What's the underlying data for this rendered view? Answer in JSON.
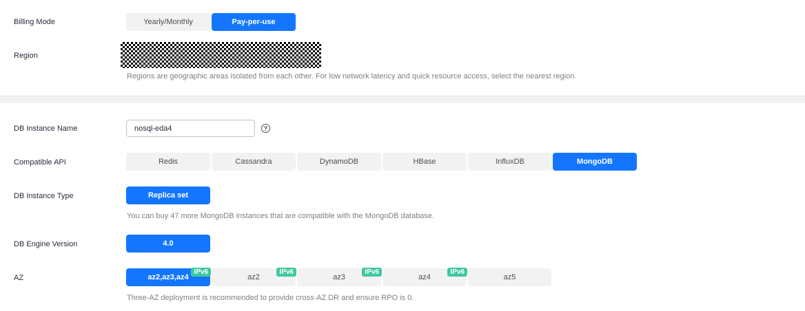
{
  "billing": {
    "label": "Billing Mode",
    "options": [
      "Yearly/Monthly",
      "Pay-per-use"
    ],
    "selected": "Pay-per-use"
  },
  "region": {
    "label": "Region",
    "hint": "Regions are geographic areas isolated from each other. For low network latency and quick resource access, select the nearest region."
  },
  "instance_name": {
    "label": "DB Instance Name",
    "value": "nosql-eda4",
    "help": "?"
  },
  "compatible_api": {
    "label": "Compatible API",
    "options": [
      "Redis",
      "Cassandra",
      "DynamoDB",
      "HBase",
      "InfluxDB",
      "MongoDB"
    ],
    "selected": "MongoDB"
  },
  "instance_type": {
    "label": "DB Instance Type",
    "option": "Replica set",
    "hint": "You can buy 47 more MongoDB instances that are compatible with the MongoDB database."
  },
  "engine_version": {
    "label": "DB Engine Version",
    "option": "4.0"
  },
  "az": {
    "label": "AZ",
    "options": [
      {
        "name": "az2,az3,az4",
        "badge": "IPv6"
      },
      {
        "name": "az2",
        "badge": "IPv6"
      },
      {
        "name": "az3",
        "badge": "IPv6"
      },
      {
        "name": "az4",
        "badge": "IPv6"
      },
      {
        "name": "az5",
        "badge": ""
      }
    ],
    "selected": "az2,az3,az4",
    "hint": "Three-AZ deployment is recommended to provide cross-AZ DR and ensure RPO is 0."
  },
  "colors": {
    "primary": "#1476ff",
    "ipv6_badge": "#3fc8a0",
    "segment_bg": "#f2f2f2"
  }
}
